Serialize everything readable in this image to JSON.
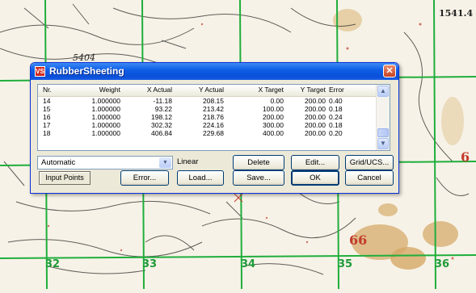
{
  "map": {
    "grid_labels": [
      "32",
      "33",
      "34",
      "35",
      "36"
    ],
    "top_right_label": "1541.4",
    "elevation_label": "5404",
    "red_label_1": "66",
    "red_label_2": "6"
  },
  "dialog": {
    "title": "RubberSheeting",
    "icon_text": "VS",
    "columns": [
      "Nr.",
      "Weight",
      "X Actual",
      "Y Actual",
      "X Target",
      "Y Target",
      "Error"
    ],
    "rows": [
      [
        "14",
        "1.000000",
        "-11.18",
        "208.15",
        "0.00",
        "200.00",
        "0.40"
      ],
      [
        "15",
        "1.000000",
        "93.22",
        "213.42",
        "100.00",
        "200.00",
        "0.18"
      ],
      [
        "16",
        "1.000000",
        "198.12",
        "218.76",
        "200.00",
        "200.00",
        "0.24"
      ],
      [
        "17",
        "1.000000",
        "302.32",
        "224.16",
        "300.00",
        "200.00",
        "0.18"
      ],
      [
        "18",
        "1.000000",
        "406.84",
        "229.68",
        "400.00",
        "200.00",
        "0.20"
      ]
    ],
    "method": "Automatic",
    "linear_label": "Linear",
    "buttons": {
      "delete": "Delete",
      "edit": "Edit...",
      "grid": "Grid/UCS...",
      "input_points": "Input Points",
      "error": "Error...",
      "load": "Load...",
      "save": "Save...",
      "ok": "OK",
      "cancel": "Cancel"
    }
  }
}
